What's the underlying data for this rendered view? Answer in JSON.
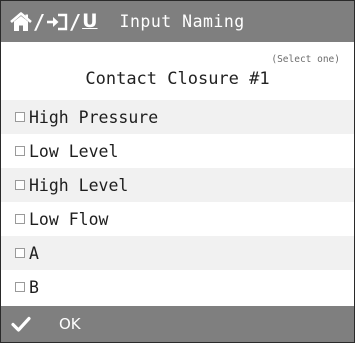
{
  "header": {
    "separator": "/",
    "home_icon": "home-icon",
    "back_icon": "enter-arrow-icon",
    "user_icon": "user-underline-icon",
    "user_glyph": "U",
    "title": "Input Naming"
  },
  "hint": "(Select one)",
  "group_title": "Contact Closure #1",
  "options": [
    {
      "label": "High Pressure",
      "checked": false
    },
    {
      "label": "Low Level",
      "checked": false
    },
    {
      "label": "High Level",
      "checked": false
    },
    {
      "label": "Low Flow",
      "checked": false
    },
    {
      "label": "A",
      "checked": false
    },
    {
      "label": "B",
      "checked": false
    }
  ],
  "footer": {
    "ok_icon": "checkmark-icon",
    "ok_label": "OK"
  },
  "colors": {
    "bar": "#7f7f7f",
    "row_alt": "#f1f1f1",
    "text": "#1e1e1e"
  }
}
